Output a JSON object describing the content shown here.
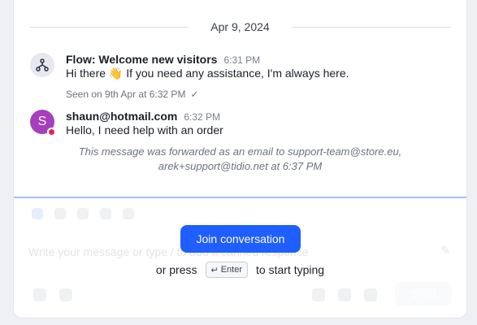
{
  "date_separator": "Apr 9, 2024",
  "messages": [
    {
      "author": "Flow: Welcome new visitors",
      "time": "6:31 PM",
      "text": "Hi there 👋 If you need any assistance, I'm always here.",
      "seen": "Seen on 9th Apr at 6:32 PM",
      "avatar_icon": "flow-icon"
    },
    {
      "author": "shaun@hotmail.com",
      "time": "6:32 PM",
      "text": "Hello, I need help with an order",
      "avatar_letter": "S",
      "status_color": "#e0284b"
    }
  ],
  "forward_notice_line1": "This message was forwarded as an email to support-team@store.eu,",
  "forward_notice_line2": "arek+support@tidio.net at 6:37 PM",
  "composer": {
    "placeholder": "Write your message or type / to add a canned response",
    "send_label": "Send"
  },
  "join_button_label": "Join conversation",
  "hint": {
    "prefix": "or press",
    "key": "Enter",
    "suffix": "to start typing"
  },
  "colors": {
    "accent": "#1f5eff",
    "avatar_user": "#a63fbd",
    "composer_border": "#a9c3f4"
  }
}
